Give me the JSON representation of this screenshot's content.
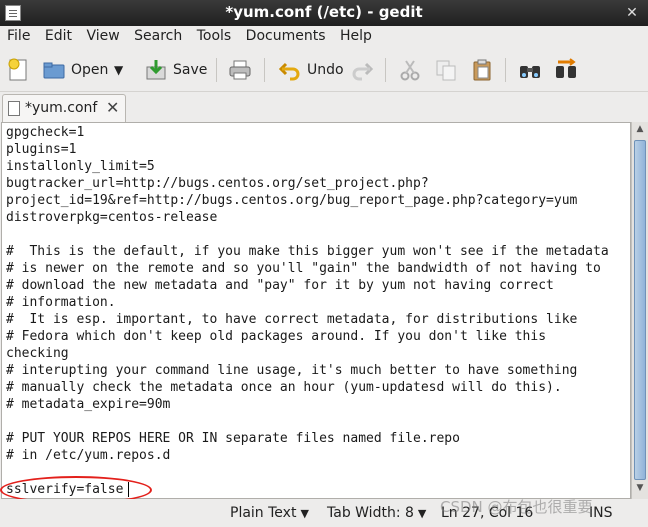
{
  "window": {
    "title": "*yum.conf (/etc) - gedit",
    "close_glyph": "✕"
  },
  "menubar": {
    "items": [
      "File",
      "Edit",
      "View",
      "Search",
      "Tools",
      "Documents",
      "Help"
    ]
  },
  "toolbar": {
    "new_icon": "new-document-icon",
    "open_label": "Open",
    "save_label": "Save",
    "undo_label": "Undo",
    "print_icon": "print-icon",
    "redo_icon": "redo-icon",
    "cut_icon": "cut-icon",
    "copy_icon": "copy-icon",
    "paste_icon": "paste-icon",
    "find_icon": "find-icon",
    "replace_icon": "find-replace-icon"
  },
  "tab": {
    "label": "*yum.conf",
    "close_glyph": "✕"
  },
  "editor": {
    "lines": [
      "gpgcheck=1",
      "plugins=1",
      "installonly_limit=5",
      "bugtracker_url=http://bugs.centos.org/set_project.php?",
      "project_id=19&ref=http://bugs.centos.org/bug_report_page.php?category=yum",
      "distroverpkg=centos-release",
      "",
      "",
      "#  This is the default, if you make this bigger yum won't see if the metadata",
      "# is newer on the remote and so you'll \"gain\" the bandwidth of not having to",
      "# download the new metadata and \"pay\" for it by yum not having correct",
      "# information.",
      "#  It is esp. important, to have correct metadata, for distributions like",
      "# Fedora which don't keep old packages around. If you don't like this",
      "checking",
      "# interupting your command line usage, it's much better to have something",
      "# manually check the metadata once an hour (yum-updatesd will do this).",
      "# metadata_expire=90m",
      "",
      "# PUT YOUR REPOS HERE OR IN separate files named file.repo",
      "# in /etc/yum.repos.d",
      "",
      "sslverify=false"
    ],
    "annotation_color": "#e3201b"
  },
  "statusbar": {
    "language": "Plain Text",
    "tab_width": "Tab Width:  8",
    "position": "Ln 27, Col 16",
    "mode": "INS"
  },
  "watermark": "CSDN @布包也很重要"
}
